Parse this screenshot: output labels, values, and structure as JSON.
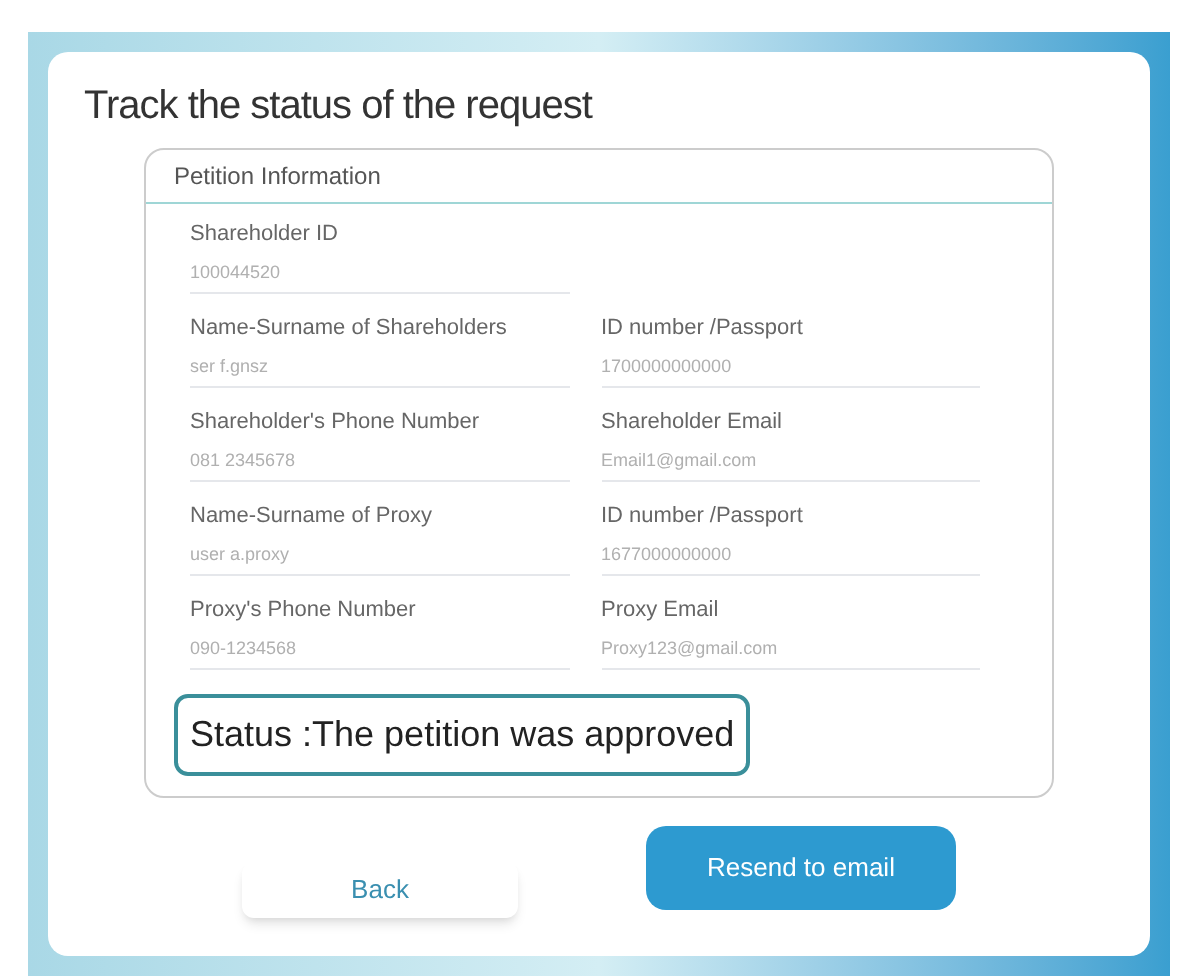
{
  "title": "Track the status of the request",
  "panel": {
    "title": "Petition Information",
    "rows": [
      [
        {
          "label": "Shareholder ID",
          "value": "100044520"
        }
      ],
      [
        {
          "label": "Name-Surname of Shareholders",
          "value": "ser f.gnsz"
        },
        {
          "label": "ID number /Passport",
          "value": "1700000000000"
        }
      ],
      [
        {
          "label": "Shareholder's Phone Number",
          "value": "081 2345678"
        },
        {
          "label": "Shareholder Email",
          "value": "Email1@gmail.com"
        }
      ],
      [
        {
          "label": "Name-Surname of Proxy",
          "value": "user a.proxy"
        },
        {
          "label": "ID number /Passport",
          "value": "1677000000000"
        }
      ],
      [
        {
          "label": "Proxy's Phone Number",
          "value": "090-1234568"
        },
        {
          "label": "Proxy Email",
          "value": "Proxy123@gmail.com"
        }
      ]
    ],
    "status": "Status :The petition was approved"
  },
  "buttons": [
    {
      "label": "Back",
      "kind": "secondary"
    },
    {
      "label": "Resend to email",
      "kind": "primary"
    }
  ]
}
